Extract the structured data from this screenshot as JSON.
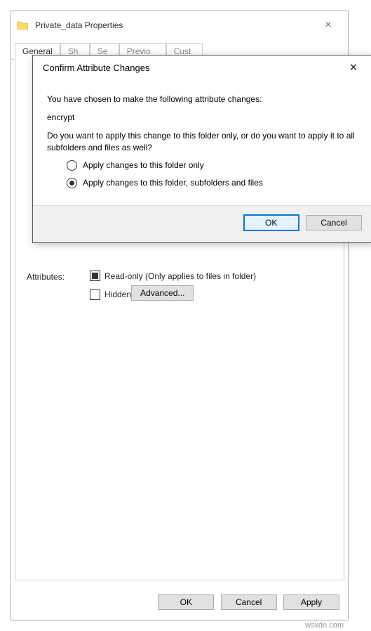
{
  "window": {
    "title": "Private_data Properties",
    "tabs": [
      "General",
      "Sharing",
      "Security",
      "Previous Versions",
      "Customize"
    ],
    "attributes_label": "Attributes:",
    "readonly_label": "Read-only (Only applies to files in folder)",
    "hidden_label": "Hidden",
    "advanced_btn": "Advanced...",
    "buttons": {
      "ok": "OK",
      "cancel": "Cancel",
      "apply": "Apply"
    }
  },
  "dialog": {
    "title": "Confirm Attribute Changes",
    "line1": "You have chosen to make the following attribute changes:",
    "change": "encrypt",
    "line2": "Do you want to apply this change to this folder only, or do you want to apply it to all subfolders and files as well?",
    "option1": "Apply changes to this folder only",
    "option2": "Apply changes to this folder, subfolders and files",
    "ok": "OK",
    "cancel": "Cancel"
  },
  "watermark": "wsxdn.com"
}
